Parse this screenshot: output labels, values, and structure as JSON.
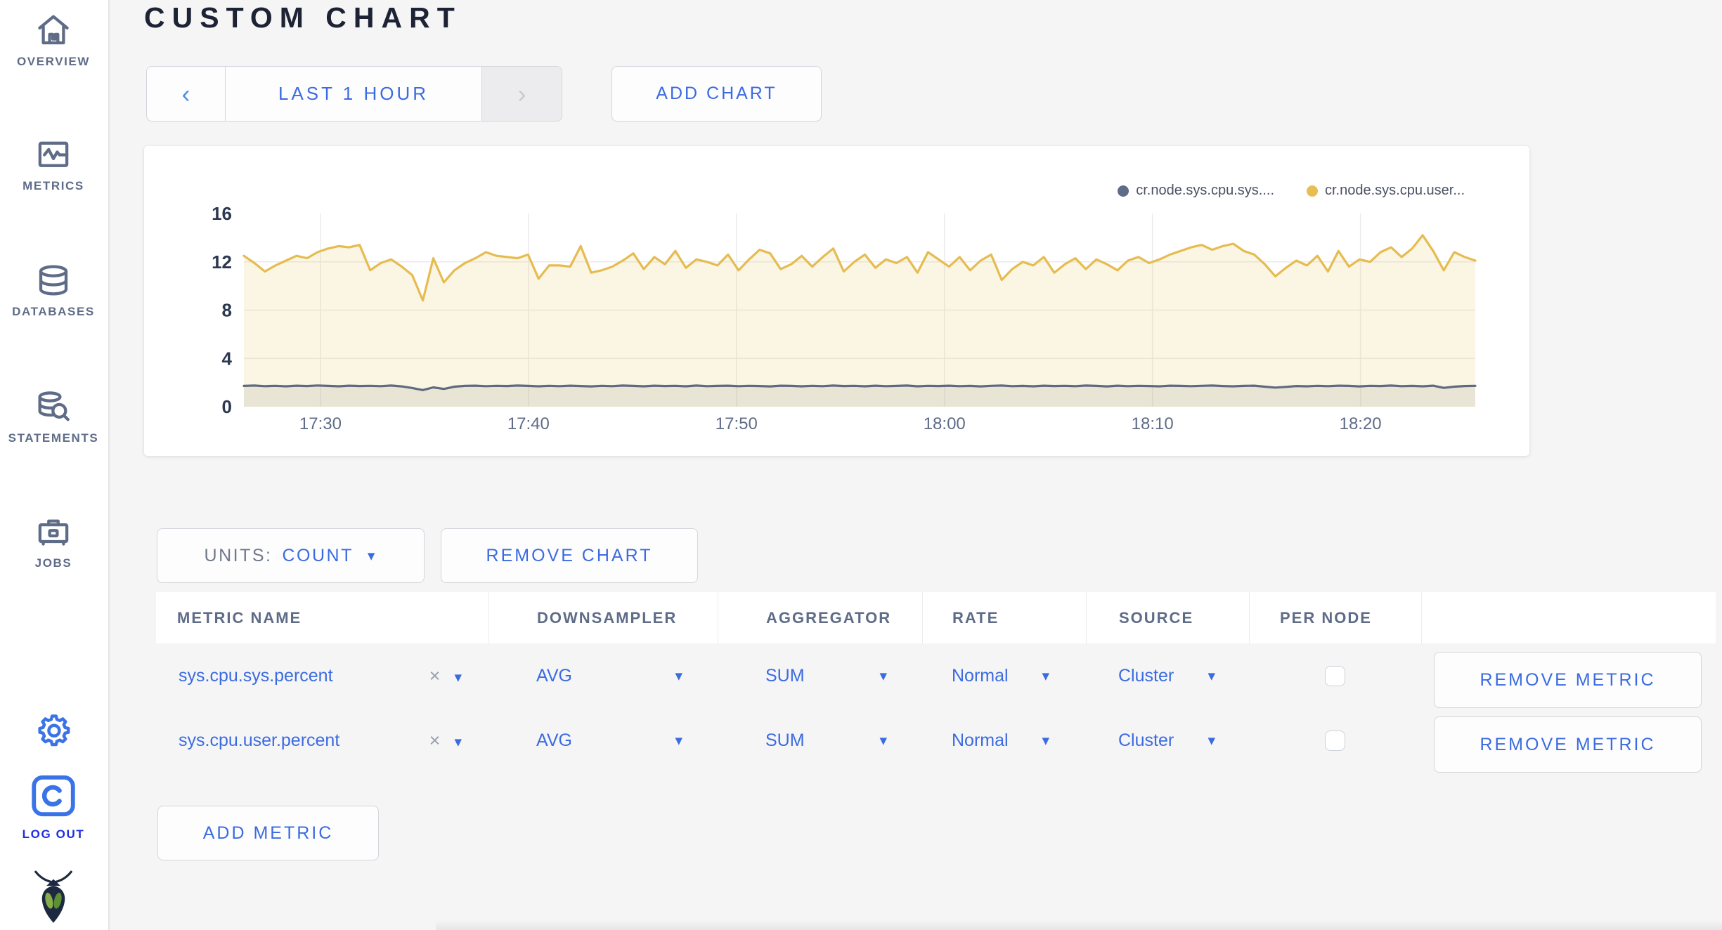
{
  "sidebar": {
    "items": [
      {
        "label": "OVERVIEW",
        "icon": "home-icon"
      },
      {
        "label": "METRICS",
        "icon": "metrics-icon"
      },
      {
        "label": "DATABASES",
        "icon": "database-icon"
      },
      {
        "label": "STATEMENTS",
        "icon": "statements-icon"
      },
      {
        "label": "JOBS",
        "icon": "briefcase-icon"
      }
    ],
    "logout_label": "LOG OUT",
    "accent_blue": "#3a73e8",
    "logout_text_color": "#1e2ce2"
  },
  "header": {
    "title": "CUSTOM CHART"
  },
  "toolbar": {
    "time_range_label": "LAST 1 HOUR",
    "prev_glyph": "‹",
    "next_glyph": "›",
    "add_chart_label": "ADD CHART"
  },
  "legend": {
    "items": [
      {
        "label": "cr.node.sys.cpu.sys....",
        "color": "#5F6C87"
      },
      {
        "label": "cr.node.sys.cpu.user...",
        "color": "#E7BE54"
      }
    ]
  },
  "chart_data": {
    "type": "line",
    "title": "",
    "xlabel": "",
    "ylabel": "",
    "ylim": [
      0,
      16
    ],
    "yticks": [
      0,
      4,
      8,
      12,
      16
    ],
    "grid": true,
    "duration_min": 59.2,
    "x_ticks": [
      {
        "label": "17:30",
        "min": 3.68
      },
      {
        "label": "17:40",
        "min": 13.68
      },
      {
        "label": "17:50",
        "min": 23.68
      },
      {
        "label": "18:00",
        "min": 33.68
      },
      {
        "label": "18:10",
        "min": 43.68
      },
      {
        "label": "18:20",
        "min": 53.68
      }
    ],
    "series": [
      {
        "name": "cr.node.sys.cpu.user...",
        "color": "#E6BC50",
        "fill": "rgba(231,190,84,0.16)",
        "values": [
          12.5,
          11.9,
          11.2,
          11.7,
          12.1,
          12.5,
          12.3,
          12.8,
          13.1,
          13.3,
          13.2,
          13.4,
          11.3,
          11.9,
          12.2,
          11.6,
          10.9,
          8.8,
          12.3,
          10.3,
          11.3,
          11.9,
          12.3,
          12.8,
          12.5,
          12.4,
          12.3,
          12.6,
          10.6,
          11.7,
          11.7,
          11.6,
          13.3,
          11.1,
          11.3,
          11.6,
          12.1,
          12.7,
          11.4,
          12.4,
          11.8,
          12.9,
          11.5,
          12.2,
          12.0,
          11.7,
          12.6,
          11.3,
          12.2,
          13.0,
          12.7,
          11.4,
          11.8,
          12.5,
          11.6,
          12.4,
          13.1,
          11.2,
          12.0,
          12.6,
          11.5,
          12.2,
          11.9,
          12.4,
          11.1,
          12.8,
          12.2,
          11.6,
          12.4,
          11.3,
          12.1,
          12.6,
          10.5,
          11.4,
          12.0,
          11.7,
          12.4,
          11.1,
          11.8,
          12.3,
          11.4,
          12.2,
          11.8,
          11.3,
          12.1,
          12.4,
          11.9,
          12.2,
          12.6,
          12.9,
          13.2,
          13.4,
          13.0,
          13.3,
          13.5,
          12.9,
          12.6,
          11.8,
          10.8,
          11.5,
          12.1,
          11.7,
          12.5,
          11.2,
          12.9,
          11.6,
          12.2,
          12.0,
          12.8,
          13.2,
          12.4,
          13.1,
          14.2,
          12.9,
          11.3,
          12.8,
          12.4,
          12.1
        ]
      },
      {
        "name": "cr.node.sys.cpu.sys....",
        "color": "#5F6A80",
        "fill": "rgba(110,112,110,0.12)",
        "values": [
          1.72,
          1.75,
          1.7,
          1.73,
          1.69,
          1.74,
          1.71,
          1.76,
          1.72,
          1.69,
          1.74,
          1.71,
          1.73,
          1.7,
          1.75,
          1.68,
          1.55,
          1.38,
          1.6,
          1.47,
          1.66,
          1.72,
          1.74,
          1.7,
          1.73,
          1.71,
          1.75,
          1.72,
          1.69,
          1.73,
          1.7,
          1.74,
          1.71,
          1.68,
          1.73,
          1.7,
          1.75,
          1.72,
          1.69,
          1.74,
          1.71,
          1.73,
          1.69,
          1.75,
          1.7,
          1.72,
          1.74,
          1.7,
          1.73,
          1.71,
          1.68,
          1.74,
          1.72,
          1.69,
          1.73,
          1.7,
          1.75,
          1.71,
          1.73,
          1.69,
          1.74,
          1.7,
          1.72,
          1.75,
          1.69,
          1.73,
          1.71,
          1.74,
          1.7,
          1.72,
          1.68,
          1.73,
          1.75,
          1.7,
          1.72,
          1.69,
          1.74,
          1.71,
          1.73,
          1.7,
          1.75,
          1.72,
          1.68,
          1.74,
          1.7,
          1.73,
          1.71,
          1.69,
          1.74,
          1.72,
          1.7,
          1.73,
          1.75,
          1.71,
          1.69,
          1.72,
          1.74,
          1.66,
          1.58,
          1.64,
          1.71,
          1.69,
          1.73,
          1.7,
          1.74,
          1.72,
          1.68,
          1.73,
          1.71,
          1.75,
          1.7,
          1.72,
          1.69,
          1.74,
          1.56,
          1.66,
          1.71,
          1.73
        ]
      }
    ],
    "axis_label_color": "#2c3850",
    "tick_label_color": "#5f6c87"
  },
  "chart_controls": {
    "units_label": "UNITS:",
    "units_value": "COUNT",
    "remove_chart_label": "REMOVE CHART",
    "add_metric_label": "ADD METRIC",
    "remove_metric_label": "REMOVE METRIC"
  },
  "table": {
    "headers": {
      "metric_name": "METRIC NAME",
      "downsampler": "DOWNSAMPLER",
      "aggregator": "AGGREGATOR",
      "rate": "RATE",
      "source": "SOURCE",
      "per_node": "PER NODE"
    },
    "rows": [
      {
        "metric": "sys.cpu.sys.percent",
        "remove_glyph": "×",
        "downsampler": "AVG",
        "aggregator": "SUM",
        "rate": "Normal",
        "source": "Cluster",
        "per_node": false
      },
      {
        "metric": "sys.cpu.user.percent",
        "remove_glyph": "×",
        "downsampler": "AVG",
        "aggregator": "SUM",
        "rate": "Normal",
        "source": "Cluster",
        "per_node": false
      }
    ]
  }
}
